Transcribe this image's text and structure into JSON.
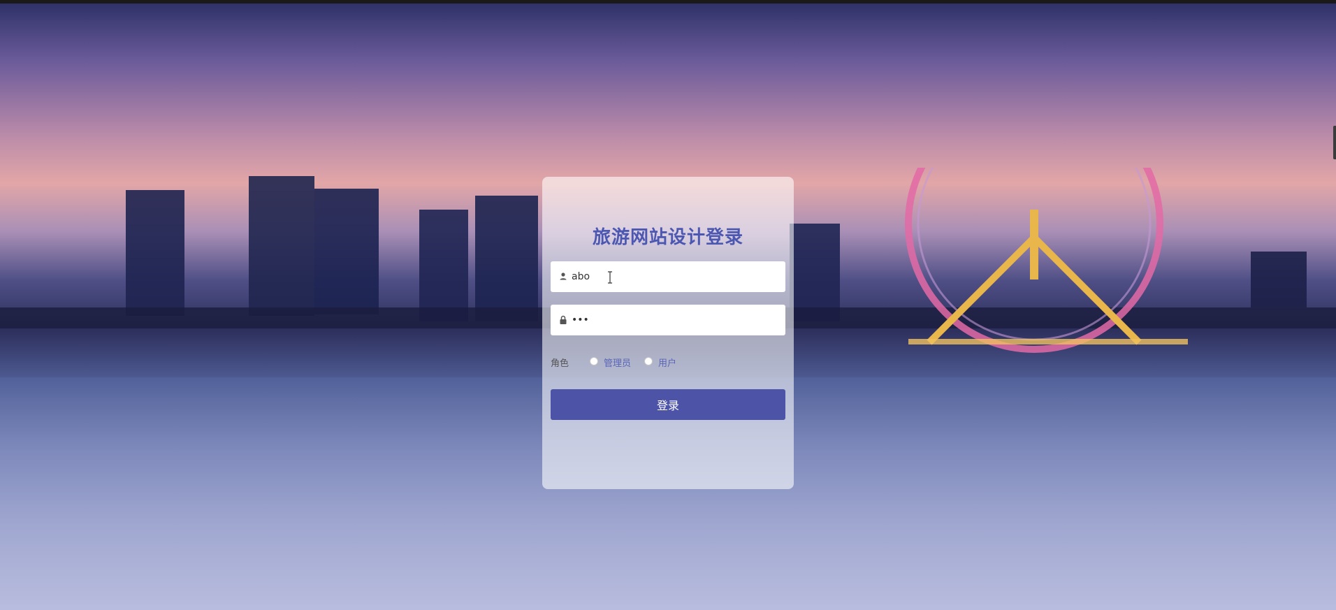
{
  "login": {
    "title": "旅游网站设计登录",
    "username": {
      "value": "abo",
      "icon": "user-icon"
    },
    "password": {
      "value": "•••",
      "icon": "lock-icon"
    },
    "role": {
      "label": "角色",
      "options": [
        "管理员",
        "用户"
      ]
    },
    "submit_label": "登录"
  },
  "colors": {
    "title": "#4b57b0",
    "button": "#4d54a8",
    "radio_text": "#5a66b8"
  }
}
